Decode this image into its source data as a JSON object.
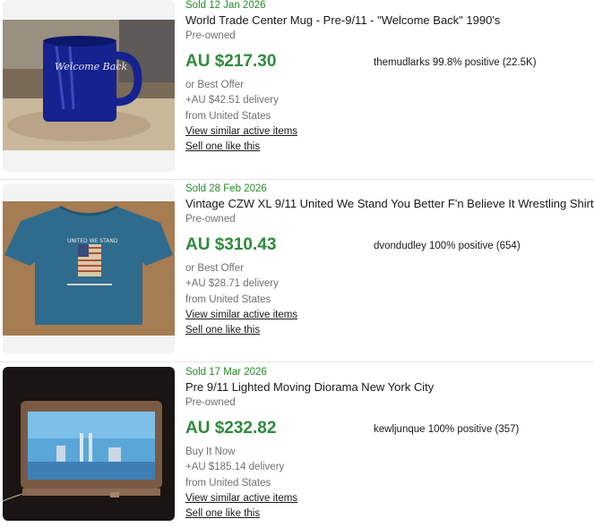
{
  "listings": [
    {
      "sold_date": "Sold 12 Jan 2026",
      "title": "World Trade Center Mug - Pre-9/11 - \"Welcome Back\" 1990's",
      "condition": "Pre-owned",
      "price": "AU $217.30",
      "seller": "themudlarks 99.8% positive (22.5K)",
      "offer": "or Best Offer",
      "delivery": "+AU $42.51 delivery",
      "origin": "from United States",
      "view_similar": "View similar active items",
      "sell_one": "Sell one like this",
      "image": "blue-mug-photo",
      "image_text": "Welcome Back"
    },
    {
      "sold_date": "Sold 28 Feb 2026",
      "title": "Vintage CZW XL 9/11 United We Stand You Better F'n Believe It Wrestling Shirt",
      "condition": "Pre-owned",
      "price": "AU $310.43",
      "seller": "dvondudley 100% positive (654)",
      "offer": "or Best Offer",
      "delivery": "+AU $28.71 delivery",
      "origin": "from United States",
      "view_similar": "View similar active items",
      "sell_one": "Sell one like this",
      "image": "blue-tshirt-photo",
      "image_text": "UNITED WE STAND"
    },
    {
      "sold_date": "Sold 17 Mar 2026",
      "title": "Pre 9/11 Lighted Moving Diorama New York City",
      "condition": "Pre-owned",
      "price": "AU $232.82",
      "seller": "kewljunque 100% positive (357)",
      "offer": "Buy It Now",
      "delivery": "+AU $185.14 delivery",
      "origin": "from United States",
      "view_similar": "View similar active items",
      "sell_one": "Sell one like this",
      "image": "lighted-diorama-photo"
    }
  ],
  "colors": {
    "sold": "#2a8a2a",
    "price": "#2e8a3c",
    "muted": "#707070",
    "text": "#191919"
  }
}
